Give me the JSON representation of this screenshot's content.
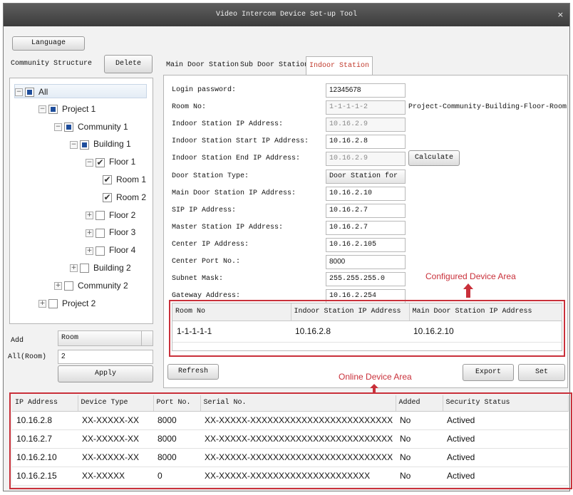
{
  "window": {
    "title": "Video Intercom Device Set-up Tool",
    "close_glyph": "×"
  },
  "language_button": "Language",
  "community": {
    "label": "Community Structure",
    "delete_button": "Delete",
    "tree": [
      {
        "label": "All",
        "level": 0,
        "expander": "−",
        "check": "partial",
        "selected": true
      },
      {
        "label": "Project 1",
        "level": 1,
        "expander": "−",
        "check": "partial"
      },
      {
        "label": "Community 1",
        "level": 2,
        "expander": "−",
        "check": "partial"
      },
      {
        "label": "Building 1",
        "level": 3,
        "expander": "−",
        "check": "partial"
      },
      {
        "label": "Floor 1",
        "level": 4,
        "expander": "−",
        "check": "checked"
      },
      {
        "label": "Room 1",
        "level": 5,
        "expander": "",
        "check": "checked"
      },
      {
        "label": "Room 2",
        "level": 5,
        "expander": "",
        "check": "checked"
      },
      {
        "label": "Floor 2",
        "level": 4,
        "expander": "+",
        "check": "none"
      },
      {
        "label": "Floor 3",
        "level": 4,
        "expander": "+",
        "check": "none"
      },
      {
        "label": "Floor 4",
        "level": 4,
        "expander": "+",
        "check": "none"
      },
      {
        "label": "Building 2",
        "level": 3,
        "expander": "+",
        "check": "none"
      },
      {
        "label": "Community 2",
        "level": 2,
        "expander": "+",
        "check": "none"
      },
      {
        "label": "Project 2",
        "level": 1,
        "expander": "+",
        "check": "none"
      }
    ],
    "check_glyph": "✔",
    "add_label": "Add",
    "add_value": "Room",
    "all_room_label": "All(Room)",
    "all_room_value": "2",
    "apply_button": "Apply"
  },
  "tabs": [
    {
      "label": "Main Door Station",
      "active": false
    },
    {
      "label": "Sub Door Station",
      "active": false
    },
    {
      "label": "Indoor Station",
      "active": true
    }
  ],
  "form": {
    "fields": [
      {
        "label": "Login password:",
        "value": "12345678",
        "readonly": false,
        "sans": true
      },
      {
        "label": "Room No:",
        "value": "1-1-1-1-2",
        "readonly": true,
        "sans": false
      },
      {
        "label": "Indoor Station IP Address:",
        "value": "10.16.2.9",
        "readonly": true,
        "sans": false
      },
      {
        "label": "Indoor Station Start IP Address:",
        "value": "10.16.2.8",
        "readonly": false,
        "sans": false
      },
      {
        "label": "Indoor Station End IP Address:",
        "value": "10.16.2.9",
        "readonly": true,
        "sans": false
      },
      {
        "label": "Door Station Type:",
        "value": "Door Station for",
        "readonly": false,
        "sans": false
      },
      {
        "label": "Main Door Station IP Address:",
        "value": "10.16.2.10",
        "readonly": false,
        "sans": false
      },
      {
        "label": "SIP IP Address:",
        "value": "10.16.2.7",
        "readonly": false,
        "sans": false
      },
      {
        "label": "Master Station IP Address:",
        "value": "10.16.2.7",
        "readonly": false,
        "sans": false
      },
      {
        "label": "Center IP Address:",
        "value": "10.16.2.105",
        "readonly": false,
        "sans": false
      },
      {
        "label": "Center Port No.:",
        "value": "8000",
        "readonly": false,
        "sans": true
      },
      {
        "label": "Subnet Mask:",
        "value": "255.255.255.0",
        "readonly": false,
        "sans": false
      },
      {
        "label": "Gateway Address:",
        "value": "10.16.2.254",
        "readonly": false,
        "sans": false
      }
    ],
    "room_hint": "Project-Community-Building-Floor-Room",
    "calculate_button": "Calculate"
  },
  "configured": {
    "caption": "Configured Device Area",
    "columns": [
      "Room No",
      "Indoor Station IP Address",
      "Main Door Station IP Address"
    ],
    "rows": [
      [
        "1-1-1-1-1",
        "10.16.2.8",
        "10.16.2.10"
      ]
    ]
  },
  "buttons": {
    "refresh": "Refresh",
    "export": "Export",
    "set": "Set"
  },
  "online": {
    "caption": "Online Device Area",
    "columns": [
      "IP Address",
      "Device Type",
      "Port No.",
      "Serial No.",
      "Added",
      "Security Status"
    ],
    "rows": [
      [
        "10.16.2.8",
        "XX-XXXXX-XX",
        "8000",
        "XX-XXXXX-XXXXXXXXXXXXXXXXXXXXXXXXX",
        "No",
        "Actived"
      ],
      [
        "10.16.2.7",
        "XX-XXXXX-XX",
        "8000",
        "XX-XXXXX-XXXXXXXXXXXXXXXXXXXXXXXXX",
        "No",
        "Actived"
      ],
      [
        "10.16.2.10",
        "XX-XXXXX-XX",
        "8000",
        "XX-XXXXX-XXXXXXXXXXXXXXXXXXXXXXXXX",
        "No",
        "Actived"
      ],
      [
        "10.16.2.15",
        "XX-XXXXX",
        "0",
        "XX-XXXXX-XXXXXXXXXXXXXXXXXXXXX",
        "No",
        "Actived"
      ]
    ]
  },
  "colors": {
    "annotation": "#c9303a",
    "active_tab": "#c0392b",
    "checkbox_fill": "#1f4e9c"
  }
}
